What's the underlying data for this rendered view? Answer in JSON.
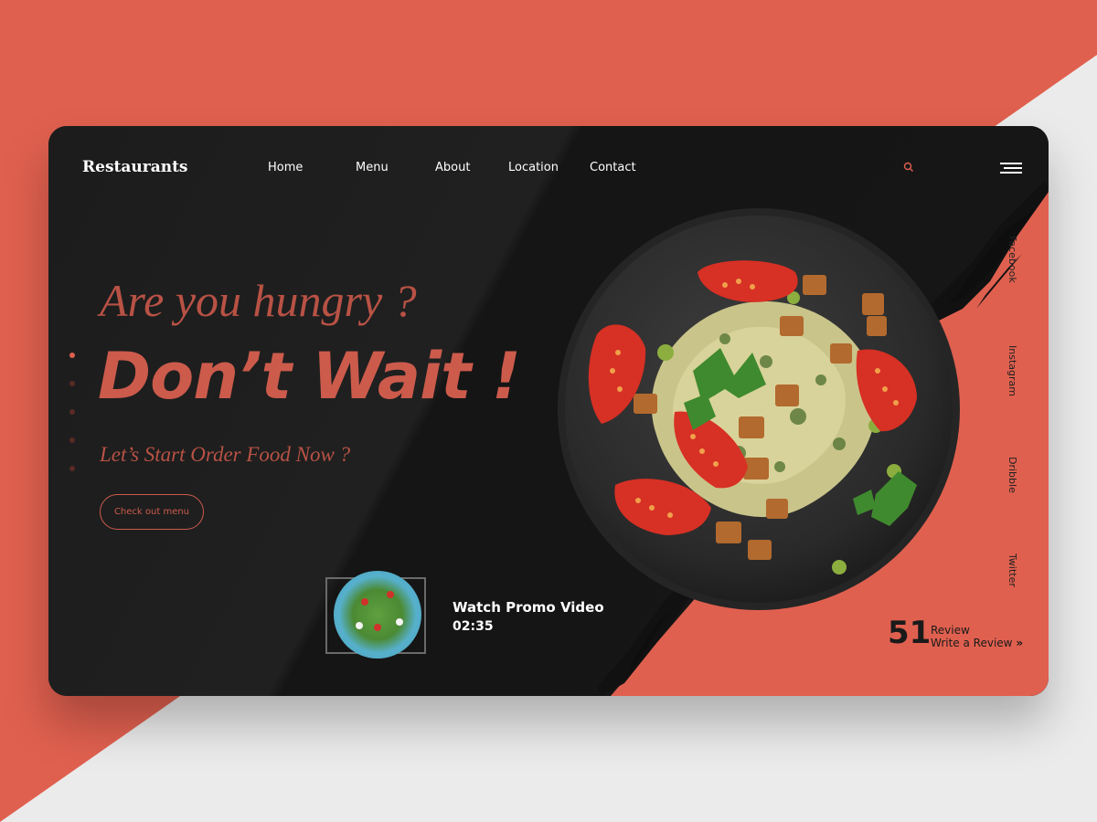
{
  "brand": "Restaurants",
  "nav": {
    "items": [
      {
        "label": "Home"
      },
      {
        "label": "Menu"
      },
      {
        "label": "About"
      },
      {
        "label": "Location"
      },
      {
        "label": "Contact"
      }
    ],
    "search_icon": "search-icon",
    "menu_icon": "hamburger-menu-icon"
  },
  "hero": {
    "tagline": "Are you hungry ?",
    "headline": "Don’t Wait !",
    "subline": "Let’s Start Order Food Now ?",
    "cta_label": "Check out menu",
    "slides_total": 5,
    "slide_active": 1
  },
  "video": {
    "title": "Watch Promo Video",
    "duration": "02:35"
  },
  "social": [
    "Facebook",
    "Instagram",
    "Dribble",
    "Twitter"
  ],
  "review": {
    "count": "51",
    "label": "Review",
    "link": "Write a Review",
    "link_icon": "double-chevron-right-icon"
  },
  "colors": {
    "accent": "#e0604f",
    "card_dark": "#1a1a1a",
    "text_light": "#ffffff"
  }
}
